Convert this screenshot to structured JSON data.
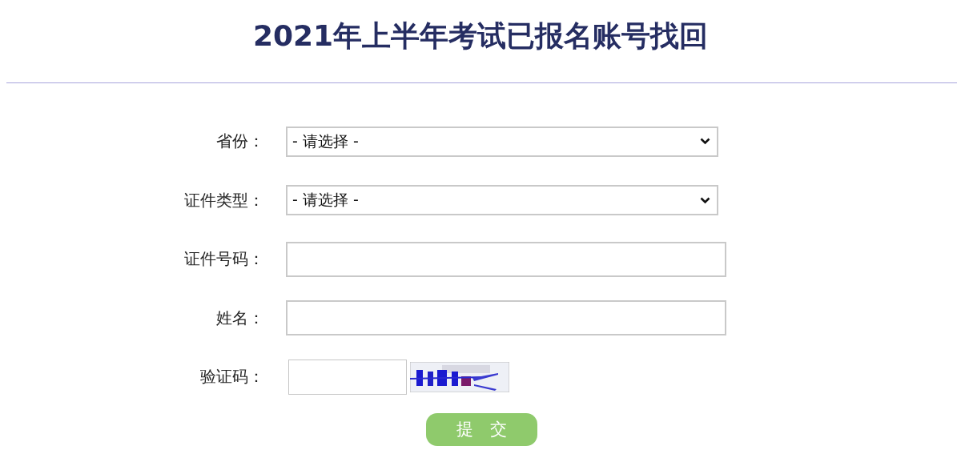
{
  "title": "2021年上半年考试已报名账号找回",
  "fields": [
    {
      "kind": "select",
      "label": "省份：",
      "value": "- 请选择 -"
    },
    {
      "kind": "select",
      "label": "证件类型：",
      "value": "- 请选择 -"
    },
    {
      "kind": "input",
      "label": "证件号码："
    },
    {
      "kind": "input",
      "label": "姓名："
    },
    {
      "kind": "captcha",
      "label": "验证码："
    }
  ],
  "submit_button": "提　交"
}
